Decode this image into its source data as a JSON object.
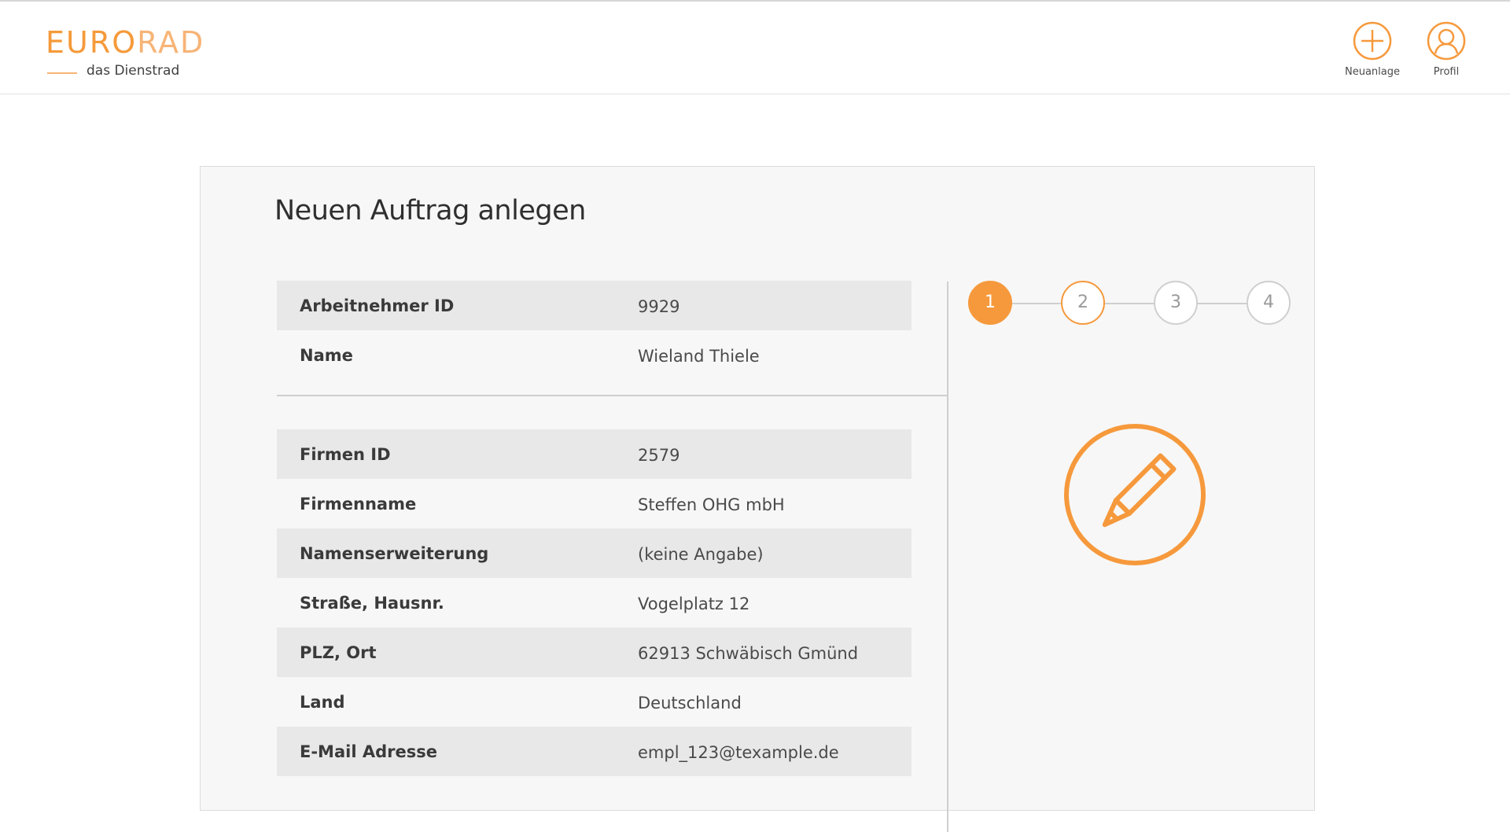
{
  "brand": {
    "logo_bold": "EURO",
    "logo_thin": "RAD",
    "tagline": "das Dienstrad",
    "accent_color": "#f6993c"
  },
  "header_actions": [
    {
      "label": "Neuanlage",
      "icon": "plus-circle-icon"
    },
    {
      "label": "Profil",
      "icon": "user-circle-icon"
    }
  ],
  "page": {
    "title": "Neuen Auftrag anlegen"
  },
  "employee": [
    {
      "key": "Arbeitnehmer ID",
      "value": "9929"
    },
    {
      "key": "Name",
      "value": "Wieland Thiele"
    }
  ],
  "company": [
    {
      "key": "Firmen ID",
      "value": "2579"
    },
    {
      "key": "Firmenname",
      "value": "Steffen OHG mbH"
    },
    {
      "key": "Namenserweiterung",
      "value": "(keine Angabe)"
    },
    {
      "key": "Straße, Hausnr.",
      "value": "Vogelplatz 12"
    },
    {
      "key": "PLZ, Ort",
      "value": "62913 Schwäbisch Gmünd"
    },
    {
      "key": "Land",
      "value": "Deutschland"
    },
    {
      "key": "E-Mail Adresse",
      "value": "empl_123@texample.de"
    }
  ],
  "stepper": {
    "steps": [
      "1",
      "2",
      "3",
      "4"
    ],
    "current_step": 1
  },
  "status_icon": "pencil-edit-icon"
}
